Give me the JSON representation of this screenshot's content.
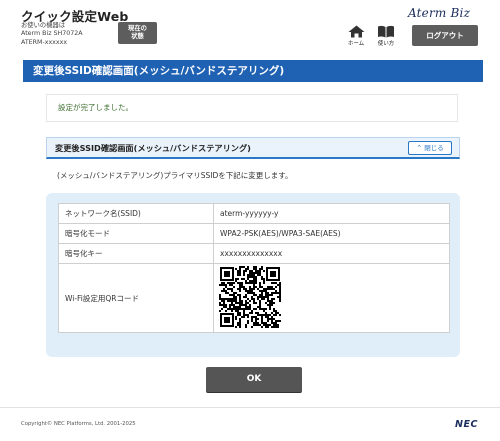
{
  "header": {
    "app_title": "クイック設定Web",
    "device_caption": "お使いの機器は",
    "device_model": "Aterm Biz SH7072A",
    "device_id": "ATERM-xxxxxx",
    "status_button": {
      "line1": "現在の",
      "line2": "状態"
    },
    "brand_logo": "Aterm Biz",
    "nav_home": "ホーム",
    "nav_help": "使い方",
    "logout_button": "ログアウト"
  },
  "page_title": "変更後SSID確認画面(メッシュ/バンドステアリング)",
  "notice": "設定が完了しました。",
  "section": {
    "title": "変更後SSID確認画面(メッシュ/バンドステアリング)",
    "close_button": "閉じる",
    "description": "(メッシュ/バンドステアリング)プライマリSSIDを下記に変更します。"
  },
  "info_table": [
    {
      "label": "ネットワーク名(SSID)",
      "value": "aterm-yyyyyy-y"
    },
    {
      "label": "暗号化モード",
      "value": "WPA2-PSK(AES)/WPA3-SAE(AES)"
    },
    {
      "label": "暗号化キー",
      "value": "xxxxxxxxxxxxxx"
    },
    {
      "label": "Wi-Fi設定用QRコード",
      "value": ""
    }
  ],
  "ok_button": "OK",
  "footer": {
    "copyright": "Copyright© NEC Platforms, Ltd. 2001-2025",
    "logo": "NEC"
  }
}
